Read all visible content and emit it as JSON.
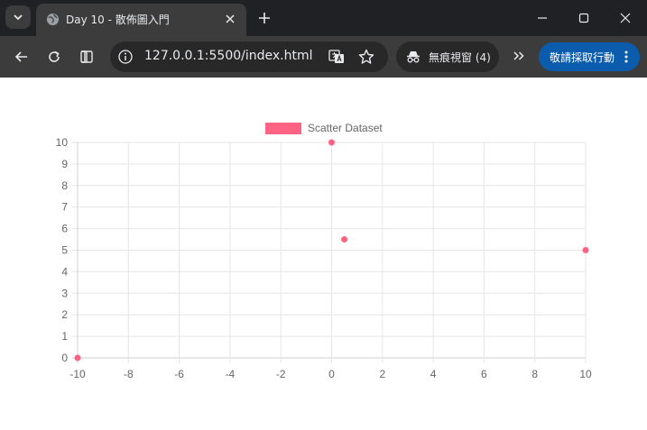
{
  "browser": {
    "tab": {
      "title": "Day 10 - 散佈圖入門",
      "favicon": "globe-icon"
    },
    "url": "127.0.0.1:5500/index.html",
    "incognito_label": "無痕視窗 (4)",
    "action_label": "敬請採取行動",
    "icons": {
      "tab_search": "chevron-down-icon",
      "tab_close": "close-icon",
      "new_tab": "plus-icon",
      "minimize": "minimize-icon",
      "maximize": "maximize-icon",
      "window_close": "close-icon",
      "back": "back-arrow-icon",
      "reload": "reload-icon",
      "split": "split-view-icon",
      "info": "info-icon",
      "translate": "translate-icon",
      "bookmark": "star-icon",
      "incognito": "incognito-icon",
      "extensions": "double-chevron-icon",
      "menu": "kebab-menu-icon"
    },
    "colors": {
      "titlebar": "#202124",
      "toolbar": "#3c3c3c",
      "omnibox": "#282828",
      "action": "#0b5cad"
    }
  },
  "chart_data": {
    "type": "scatter",
    "legend": {
      "label": "Scatter Dataset",
      "position": "top"
    },
    "series": [
      {
        "name": "Scatter Dataset",
        "color": "#ff6384",
        "points": [
          {
            "x": -10,
            "y": 0
          },
          {
            "x": 0,
            "y": 10
          },
          {
            "x": 10,
            "y": 5
          },
          {
            "x": 0.5,
            "y": 5.5
          }
        ]
      }
    ],
    "xlim": [
      -10,
      10
    ],
    "ylim": [
      0,
      10
    ],
    "xticks": [
      -10,
      -8,
      -6,
      -4,
      -2,
      0,
      2,
      4,
      6,
      8,
      10
    ],
    "yticks": [
      0,
      1,
      2,
      3,
      4,
      5,
      6,
      7,
      8,
      9,
      10
    ],
    "grid": true
  }
}
